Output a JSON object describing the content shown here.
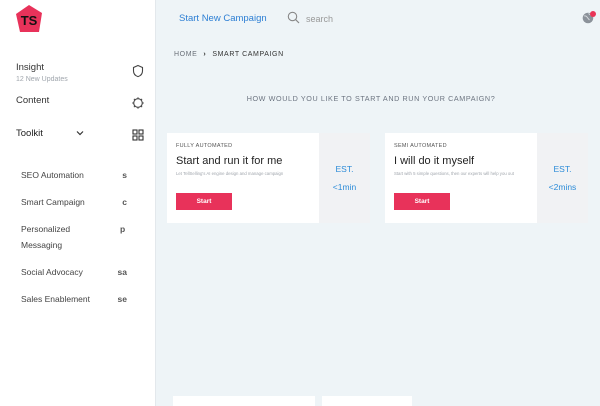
{
  "brand": {
    "logo_text": "TS",
    "logo_color": "#e8325a"
  },
  "sidebar": {
    "insight": {
      "label": "Insight",
      "sub": "12 New Updates"
    },
    "content": {
      "label": "Content"
    },
    "toolkit": {
      "label": "Toolkit"
    },
    "tools": [
      {
        "label": "SEO Automation",
        "code": "s"
      },
      {
        "label": "Smart Campaign",
        "code": "c"
      },
      {
        "label": "Personalized Messaging",
        "code": "p"
      },
      {
        "label": "Social Advocacy",
        "code": "sa"
      },
      {
        "label": "Sales Enablement",
        "code": "se"
      }
    ]
  },
  "topbar": {
    "start_campaign": "Start New Campaign",
    "search_placeholder": "search"
  },
  "breadcrumb": {
    "home": "HOME",
    "current": "SMART CAMPAIGN"
  },
  "question": "HOW WOULD YOU LIKE TO START AND RUN YOUR CAMPAIGN?",
  "cards": [
    {
      "tag": "FULLY AUTOMATED",
      "title": "Start and run it for me",
      "desc": "Let TellSelling's AI engine design and manage campaign",
      "button": "Start",
      "est_label": "EST.",
      "est_value": "<1min"
    },
    {
      "tag": "SEMI AUTOMATED",
      "title": "I will do it myself",
      "desc": "Start with 5 simple questions, then our experts will help you out",
      "button": "Start",
      "est_label": "EST.",
      "est_value": "<2mins"
    }
  ],
  "colors": {
    "accent_link": "#2d7fd4",
    "button": "#e8325a",
    "background": "#eef4f7"
  }
}
